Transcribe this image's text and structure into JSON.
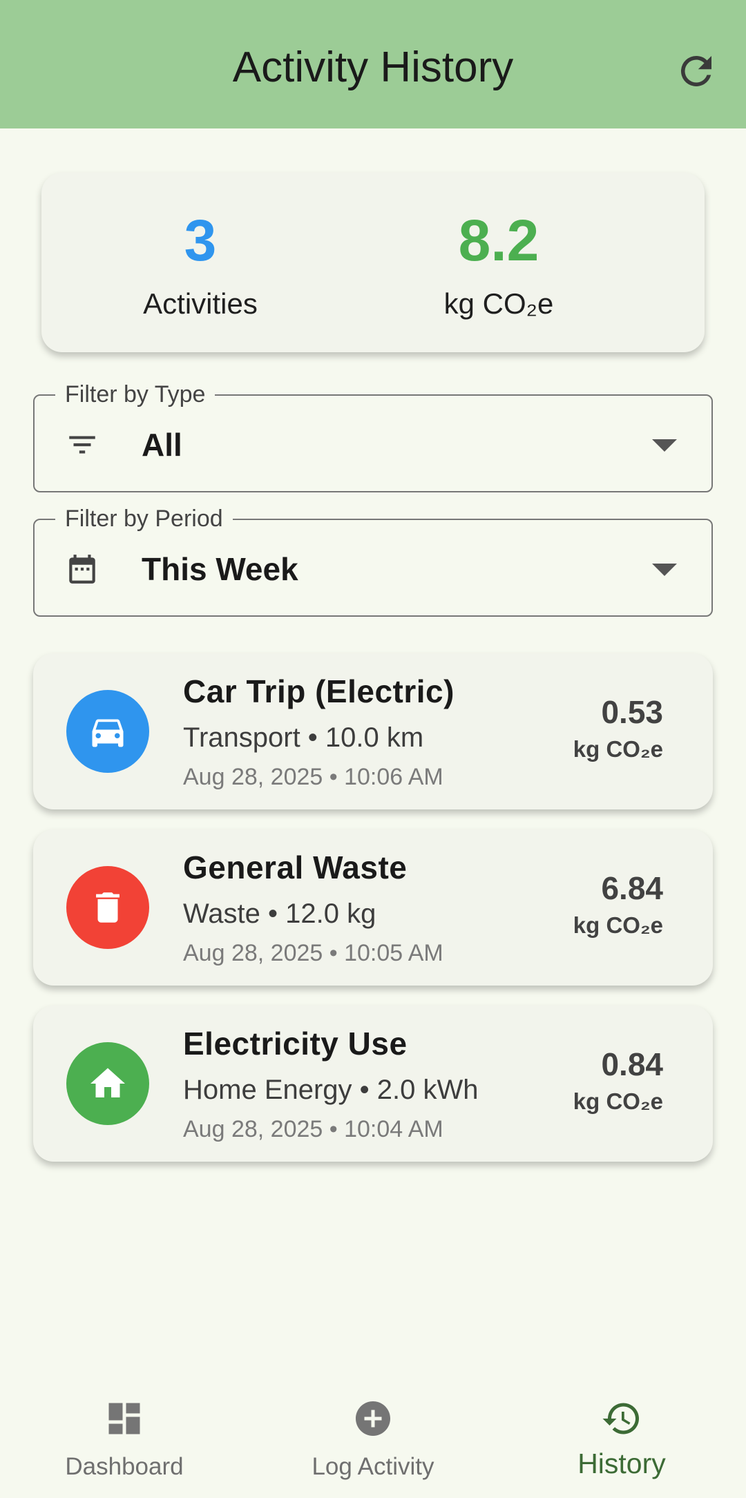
{
  "header": {
    "title": "Activity History"
  },
  "summary": {
    "count_value": "3",
    "count_label": "Activities",
    "emissions_value": "8.2",
    "emissions_label": "kg CO₂e"
  },
  "filters": [
    {
      "legend": "Filter by Type",
      "value": "All",
      "icon": "filter-icon"
    },
    {
      "legend": "Filter by Period",
      "value": "This Week",
      "icon": "calendar-icon"
    }
  ],
  "activities": [
    {
      "title": "Car Trip (Electric)",
      "subtitle": "Transport • 10.0 km",
      "date": "Aug 28, 2025 • 10:06 AM",
      "amount": "0.53",
      "unit": "kg CO₂e",
      "icon": "car-icon",
      "color": "#2f95ee"
    },
    {
      "title": "General Waste",
      "subtitle": "Waste • 12.0 kg",
      "date": "Aug 28, 2025 • 10:05 AM",
      "amount": "6.84",
      "unit": "kg CO₂e",
      "icon": "trash-icon",
      "color": "#f24236"
    },
    {
      "title": "Electricity Use",
      "subtitle": "Home Energy • 2.0 kWh",
      "date": "Aug 28, 2025 • 10:04 AM",
      "amount": "0.84",
      "unit": "kg CO₂e",
      "icon": "home-icon",
      "color": "#4caf50"
    }
  ],
  "nav": [
    {
      "label": "Dashboard",
      "icon": "dashboard-icon"
    },
    {
      "label": "Log Activity",
      "icon": "add-circle-icon"
    },
    {
      "label": "History",
      "icon": "history-icon",
      "active": true
    }
  ],
  "colors": {
    "appbar": "#9ccc96",
    "count": "#2f95ee",
    "emissions": "#4caf50",
    "nav_active": "#3c6b35"
  }
}
